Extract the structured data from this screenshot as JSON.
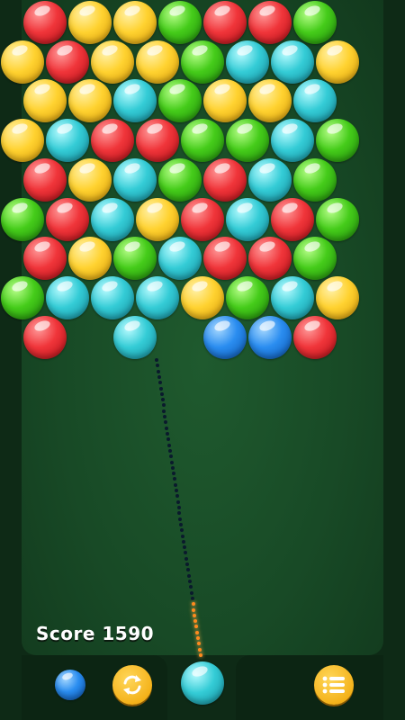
{
  "game": {
    "score_text": "Score 1590",
    "colors": {
      "red": "#f0353a",
      "yellow": "#ffd230",
      "green": "#45cc1a",
      "cyan": "#34ccd6",
      "blue": "#2a8df0",
      "background": "#184a26"
    },
    "board_rows": [
      [
        "red",
        "yellow",
        "yellow",
        "green",
        "red",
        "red",
        "green"
      ],
      [
        "yellow",
        "red",
        "yellow",
        "yellow",
        "green",
        "cyan",
        "cyan",
        "yellow"
      ],
      [
        "yellow",
        "yellow",
        "cyan",
        "green",
        "yellow",
        "yellow",
        "cyan"
      ],
      [
        "yellow",
        "cyan",
        "red",
        "red",
        "green",
        "green",
        "cyan",
        "green"
      ],
      [
        "red",
        "yellow",
        "cyan",
        "green",
        "red",
        "cyan",
        "green"
      ],
      [
        "green",
        "red",
        "cyan",
        "yellow",
        "red",
        "cyan",
        "red",
        "green"
      ],
      [
        "red",
        "yellow",
        "green",
        "cyan",
        "red",
        "red",
        "green"
      ],
      [
        "green",
        "cyan",
        "cyan",
        "cyan",
        "yellow",
        "green",
        "cyan",
        "yellow"
      ],
      [
        "red",
        null,
        "cyan",
        null,
        "blue",
        "blue",
        "red"
      ]
    ],
    "current_bubble_color": "cyan",
    "next_bubble_color": "blue",
    "swap_icon": "swap-icon",
    "menu_icon": "list-menu-icon"
  }
}
